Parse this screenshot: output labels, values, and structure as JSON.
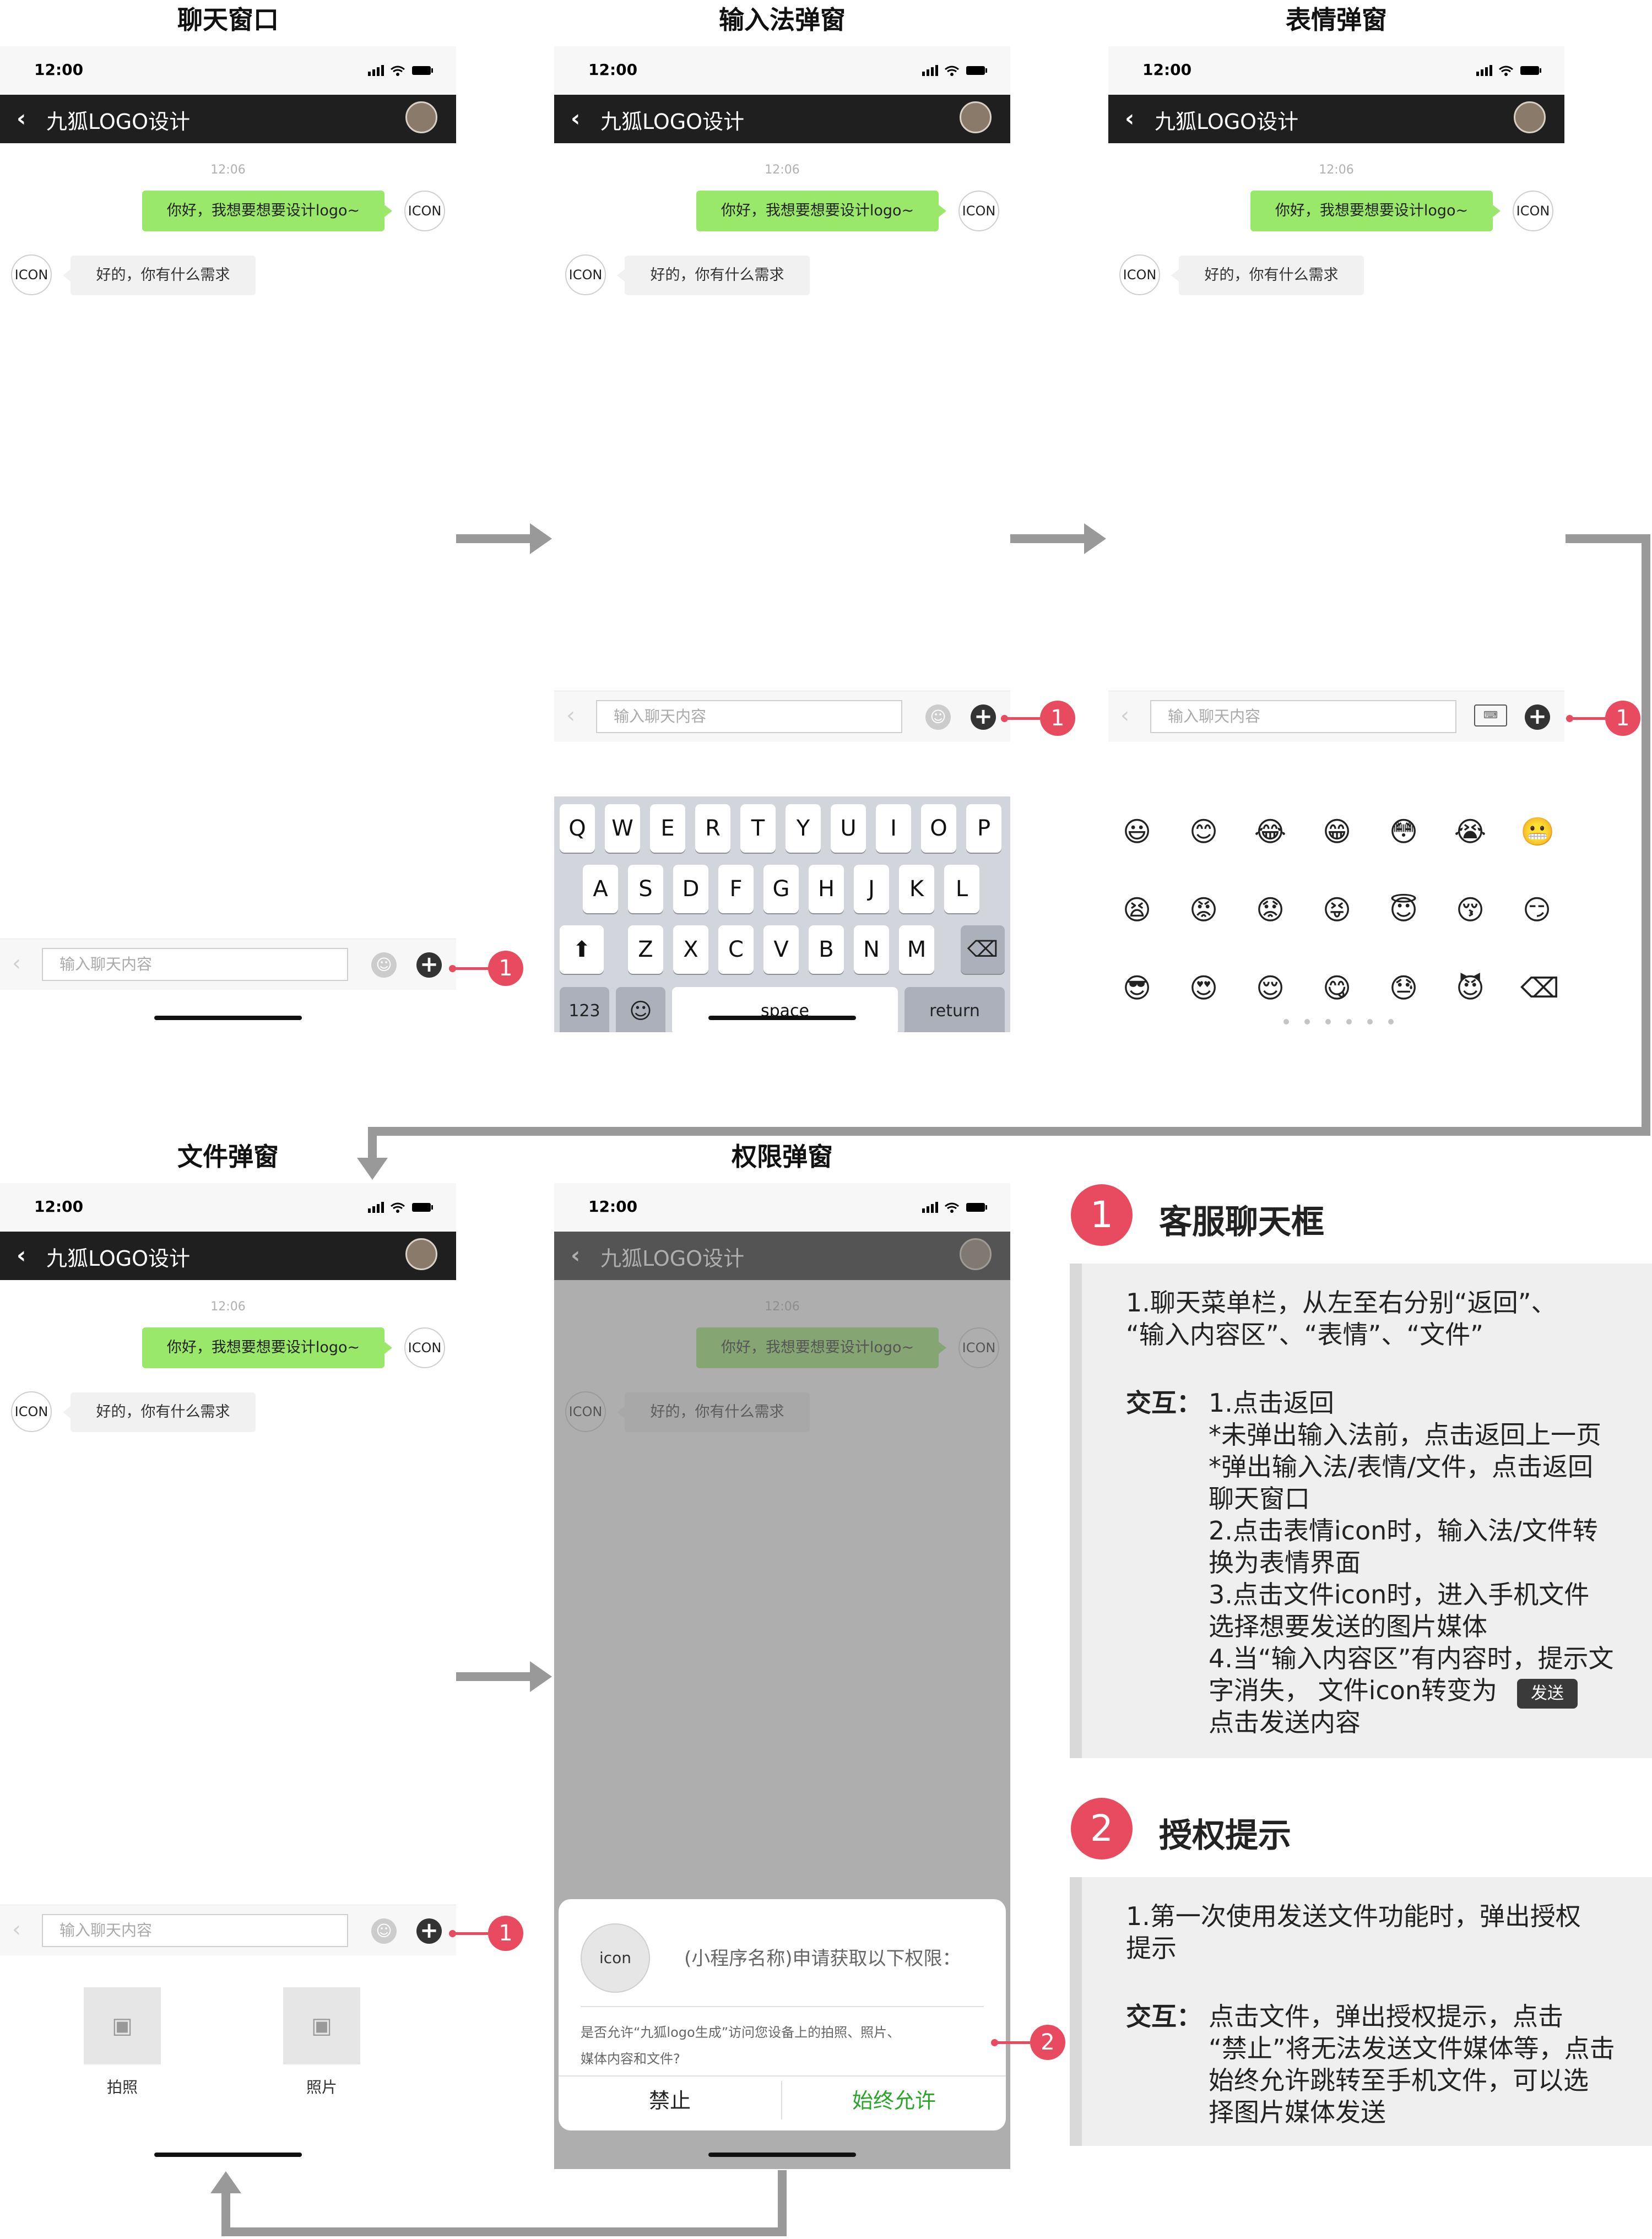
{
  "screens": {
    "chat": {
      "title": "聊天窗口"
    },
    "keyboard": {
      "title": "输入法弹窗"
    },
    "emoji": {
      "title": "表情弹窗"
    },
    "file": {
      "title": "文件弹窗"
    },
    "permission": {
      "title": "权限弹窗"
    }
  },
  "phone": {
    "time": "12:00",
    "nav_title": "九狐LOGO设计",
    "msg_time": "12:06",
    "my_message": "你好，我想要想要设计logo~",
    "other_message": "好的，你有什么需求",
    "icon_label": "ICON",
    "input_placeholder": "输入聊天内容"
  },
  "keyboard": {
    "row1": [
      "Q",
      "W",
      "E",
      "R",
      "T",
      "Y",
      "U",
      "I",
      "O",
      "P"
    ],
    "row2": [
      "A",
      "S",
      "D",
      "F",
      "G",
      "H",
      "J",
      "K",
      "L"
    ],
    "row3": [
      "Z",
      "X",
      "C",
      "V",
      "B",
      "N",
      "M"
    ],
    "num_key": "123",
    "space_key": "space",
    "return_key": "return"
  },
  "emoji_panel": {
    "rows": [
      [
        "😃",
        "😊",
        "😂",
        "😁",
        "😳",
        "😭",
        "😬"
      ],
      [
        "😫",
        "😡",
        "😟",
        "😝",
        "😇",
        "😚",
        "😏"
      ],
      [
        "😎",
        "😍",
        "😌",
        "😋",
        "😓",
        "😈",
        "⌫"
      ]
    ]
  },
  "file_panel": {
    "photo_label": "拍照",
    "album_label": "照片"
  },
  "permission_dialog": {
    "icon_label": "icon",
    "request_title": "(小程序名称)申请获取以下权限：",
    "request_desc_1": "是否允许“九狐logo生成”访问您设备上的拍照、照片、",
    "request_desc_2": "媒体内容和文件?",
    "deny_label": "禁止",
    "allow_label": "始终允许"
  },
  "markers": {
    "one": "1",
    "two": "2"
  },
  "section1": {
    "num": "1",
    "title": "客服聊天框",
    "lines": [
      "1.聊天菜单栏，从左至右分别“返回”、",
      "“输入内容区”、“表情”、“文件”"
    ],
    "interaction_label": "交互：",
    "interaction_lines": [
      "1.点击返回",
      "*未弹出输入法前，点击返回上一页",
      "*弹出输入法/表情/文件，点击返回",
      " 聊天窗口",
      "2.点击表情icon时，输入法/文件转",
      "换为表情界面",
      "3.点击文件icon时，进入手机文件",
      "选择想要发送的图片媒体",
      "4.当“输入内容区”有内容时，提示文",
      "字消失， 文件icon转变为",
      "点击发送内容"
    ],
    "send_button": "发送"
  },
  "section2": {
    "num": "2",
    "title": "授权提示",
    "lines": [
      "1.第一次使用发送文件功能时，弹出授权",
      "提示"
    ],
    "interaction_label": "交互：",
    "interaction_lines": [
      "点击文件，弹出授权提示，点击",
      "“禁止”将无法发送文件媒体等，点击",
      "始终允许跳转至手机文件，可以选",
      "择图片媒体发送"
    ]
  }
}
